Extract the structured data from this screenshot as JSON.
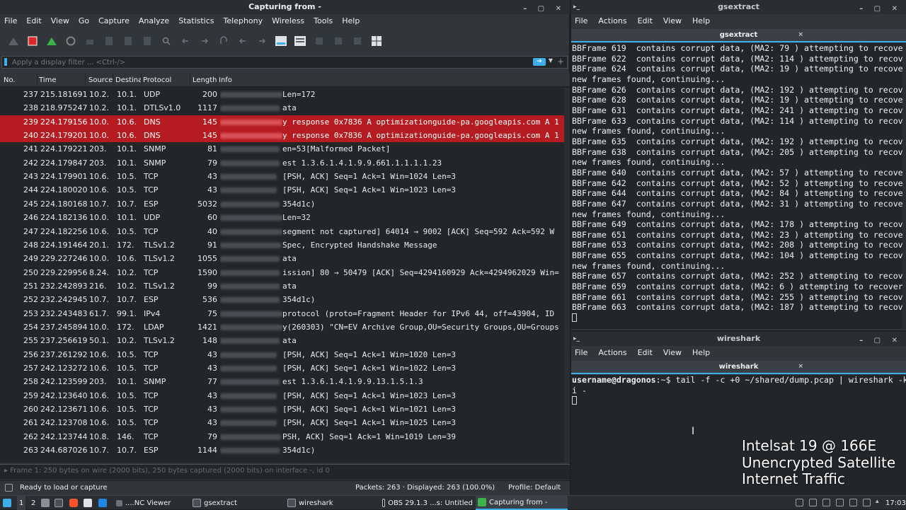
{
  "wireshark": {
    "title": "Capturing from -",
    "window_buttons": "– ▢ ✕",
    "menu": [
      "File",
      "Edit",
      "View",
      "Go",
      "Capture",
      "Analyze",
      "Statistics",
      "Telephony",
      "Wireless",
      "Tools",
      "Help"
    ],
    "filter_placeholder": "Apply a display filter ... <Ctrl-/>",
    "columns": [
      "No.",
      "Time",
      "Source",
      "Destinat",
      "Protocol",
      "Length",
      "Info"
    ],
    "packets": [
      {
        "no": "237",
        "time": "215.181691",
        "src": "10.2.",
        "dst": "10.1.",
        "proto": "UDP",
        "len": "200",
        "info": "Len=172",
        "blur": 88,
        "hl": false
      },
      {
        "no": "238",
        "time": "218.975247",
        "src": "10.2.",
        "dst": "10.1.",
        "proto": "DTLSv1.0",
        "len": "1117",
        "info": "ata",
        "blur": 84,
        "hl": false
      },
      {
        "no": "239",
        "time": "224.179156",
        "src": "10.0.",
        "dst": "10.6.",
        "proto": "DNS",
        "len": "145",
        "info": "y response 0x7836 A optimizationguide-pa.googleapis.com A 1",
        "blur": 88,
        "hl": true
      },
      {
        "no": "240",
        "time": "224.179201",
        "src": "10.0.",
        "dst": "10.6.",
        "proto": "DNS",
        "len": "145",
        "info": "y response 0x7836 A optimizationguide-pa.googleapis.com A 1",
        "blur": 88,
        "hl": true
      },
      {
        "no": "241",
        "time": "224.179221",
        "src": "203.",
        "dst": "10.1.",
        "proto": "SNMP",
        "len": "81",
        "info": "en=53[Malformed Packet]",
        "blur": 84,
        "hl": false
      },
      {
        "no": "242",
        "time": "224.179847",
        "src": "203.",
        "dst": "10.1.",
        "proto": "SNMP",
        "len": "79",
        "info": "est 1.3.6.1.4.1.9.9.661.1.1.1.1.23",
        "blur": 84,
        "hl": false
      },
      {
        "no": "243",
        "time": "224.179901",
        "src": "10.6.",
        "dst": "10.5.",
        "proto": "TCP",
        "len": "43",
        "info": "[PSH, ACK] Seq=1 Ack=1 Win=1024 Len=3",
        "blur": 80,
        "hl": false
      },
      {
        "no": "244",
        "time": "224.180020",
        "src": "10.6.",
        "dst": "10.5.",
        "proto": "TCP",
        "len": "43",
        "info": "[PSH, ACK] Seq=1 Ack=1 Win=1023 Len=3",
        "blur": 80,
        "hl": false
      },
      {
        "no": "245",
        "time": "224.180168",
        "src": "10.7.",
        "dst": "10.7.",
        "proto": "ESP",
        "len": "5032",
        "info": "354d1c)",
        "blur": 84,
        "hl": false
      },
      {
        "no": "246",
        "time": "224.182136",
        "src": "10.0.",
        "dst": "10.1.",
        "proto": "UDP",
        "len": "60",
        "info": "Len=32",
        "blur": 88,
        "hl": false
      },
      {
        "no": "247",
        "time": "224.182256",
        "src": "10.6.",
        "dst": "10.5.",
        "proto": "TCP",
        "len": "40",
        "info": "segment not captured] 64014 → 9002 [ACK] Seq=592 Ack=592 W",
        "blur": 88,
        "hl": false
      },
      {
        "no": "248",
        "time": "224.191464",
        "src": "20.1.",
        "dst": "172.",
        "proto": "TLSv1.2",
        "len": "91",
        "info": "Spec, Encrypted Handshake Message",
        "blur": 86,
        "hl": false
      },
      {
        "no": "249",
        "time": "229.227246",
        "src": "10.0.",
        "dst": "10.6.",
        "proto": "TLSv1.2",
        "len": "1055",
        "info": "ata",
        "blur": 84,
        "hl": false
      },
      {
        "no": "250",
        "time": "229.229956",
        "src": "8.24.",
        "dst": "10.2.",
        "proto": "TCP",
        "len": "1590",
        "info": "ission] 80 → 50479 [ACK] Seq=4294160929 Ack=4294962029 Win=",
        "blur": 84,
        "hl": false
      },
      {
        "no": "251",
        "time": "232.242893",
        "src": "216.",
        "dst": "10.2.",
        "proto": "TLSv1.2",
        "len": "99",
        "info": "ata",
        "blur": 84,
        "hl": false
      },
      {
        "no": "252",
        "time": "232.242945",
        "src": "10.7.",
        "dst": "10.7.",
        "proto": "ESP",
        "len": "536",
        "info": "354d1c)",
        "blur": 84,
        "hl": false
      },
      {
        "no": "253",
        "time": "232.243483",
        "src": "61.7.",
        "dst": "99.1.",
        "proto": "IPv4",
        "len": "75",
        "info": "protocol (proto=Fragment Header for IPv6 44, off=43904, ID",
        "blur": 88,
        "hl": false
      },
      {
        "no": "254",
        "time": "237.245894",
        "src": "10.0.",
        "dst": "172.",
        "proto": "LDAP",
        "len": "1421",
        "info": "y(260303) \"CN=EV Archive Group,OU=Security Groups,OU=Groups",
        "blur": 88,
        "hl": false
      },
      {
        "no": "255",
        "time": "237.256619",
        "src": "50.1.",
        "dst": "10.2.",
        "proto": "TLSv1.2",
        "len": "148",
        "info": "ata",
        "blur": 84,
        "hl": false
      },
      {
        "no": "256",
        "time": "237.261292",
        "src": "10.6.",
        "dst": "10.5.",
        "proto": "TCP",
        "len": "43",
        "info": "[PSH, ACK] Seq=1 Ack=1 Win=1020 Len=3",
        "blur": 80,
        "hl": false
      },
      {
        "no": "257",
        "time": "242.123272",
        "src": "10.6.",
        "dst": "10.5.",
        "proto": "TCP",
        "len": "43",
        "info": "[PSH, ACK] Seq=1 Ack=1 Win=1022 Len=3",
        "blur": 80,
        "hl": false
      },
      {
        "no": "258",
        "time": "242.123599",
        "src": "203.",
        "dst": "10.1.",
        "proto": "SNMP",
        "len": "77",
        "info": "est 1.3.6.1.4.1.9.9.13.1.5.1.3",
        "blur": 84,
        "hl": false
      },
      {
        "no": "259",
        "time": "242.123640",
        "src": "10.6.",
        "dst": "10.5.",
        "proto": "TCP",
        "len": "43",
        "info": "[PSH, ACK] Seq=1 Ack=1 Win=1023 Len=3",
        "blur": 80,
        "hl": false
      },
      {
        "no": "260",
        "time": "242.123671",
        "src": "10.6.",
        "dst": "10.5.",
        "proto": "TCP",
        "len": "43",
        "info": "[PSH, ACK] Seq=1 Ack=1 Win=1021 Len=3",
        "blur": 80,
        "hl": false
      },
      {
        "no": "261",
        "time": "242.123708",
        "src": "10.6.",
        "dst": "10.5.",
        "proto": "TCP",
        "len": "43",
        "info": "[PSH, ACK] Seq=1 Ack=1 Win=1025 Len=3",
        "blur": 80,
        "hl": false
      },
      {
        "no": "262",
        "time": "242.123744",
        "src": "10.8.",
        "dst": "146.",
        "proto": "TCP",
        "len": "79",
        "info": "PSH, ACK] Seq=1 Ack=1 Win=1019 Len=39",
        "blur": 86,
        "hl": false
      },
      {
        "no": "263",
        "time": "244.687026",
        "src": "10.7.",
        "dst": "10.7.",
        "proto": "ESP",
        "len": "1144",
        "info": "354d1c)",
        "blur": 84,
        "hl": false
      }
    ],
    "detail_line": "▸ Frame 1: 250 bytes on wire (2000 bits), 250 bytes captured (2000 bits) on interface -, id 0",
    "status": {
      "ready": "Ready to load or capture",
      "packets": "Packets: 263 · Displayed: 263 (100.0%)",
      "profile": "Profile: Default"
    }
  },
  "gsextract": {
    "title": "gsextract",
    "menu": [
      "File",
      "Actions",
      "Edit",
      "View",
      "Help"
    ],
    "tab": "gsextract",
    "tab_close": "×",
    "lines": [
      "BBFrame 619  contains corrupt data, (MA2: 79 ) attempting to recover",
      "BBFrame 622  contains corrupt data, (MA2: 114 ) attempting to recover",
      "BBFrame 624  contains corrupt data, (MA2: 19 ) attempting to recover",
      "new frames found, continuing...",
      "BBFrame 626  contains corrupt data, (MA2: 192 ) attempting to recover",
      "BBFrame 628  contains corrupt data, (MA2: 19 ) attempting to recover",
      "BBFrame 631  contains corrupt data, (MA2: 241 ) attempting to recover",
      "BBFrame 633  contains corrupt data, (MA2: 114 ) attempting to recover",
      "new frames found, continuing...",
      "BBFrame 635  contains corrupt data, (MA2: 192 ) attempting to recover",
      "BBFrame 638  contains corrupt data, (MA2: 205 ) attempting to recover",
      "new frames found, continuing...",
      "BBFrame 640  contains corrupt data, (MA2: 57 ) attempting to recover",
      "BBFrame 642  contains corrupt data, (MA2: 52 ) attempting to recover",
      "BBFrame 644  contains corrupt data, (MA2: 84 ) attempting to recover",
      "BBFrame 647  contains corrupt data, (MA2: 31 ) attempting to recover",
      "new frames found, continuing...",
      "BBFrame 649  contains corrupt data, (MA2: 178 ) attempting to recover",
      "BBFrame 651  contains corrupt data, (MA2: 23 ) attempting to recover",
      "BBFrame 653  contains corrupt data, (MA2: 208 ) attempting to recover",
      "BBFrame 655  contains corrupt data, (MA2: 104 ) attempting to recover",
      "new frames found, continuing...",
      "BBFrame 657  contains corrupt data, (MA2: 252 ) attempting to recover",
      "BBFrame 659  contains corrupt data, (MA2: 6 ) attempting to recover",
      "BBFrame 661  contains corrupt data, (MA2: 255 ) attempting to recover",
      "BBFrame 663  contains corrupt data, (MA2: 187 ) attempting to recover"
    ]
  },
  "wireshark_term": {
    "title": "wireshark",
    "menu": [
      "File",
      "Actions",
      "Edit",
      "View",
      "Help"
    ],
    "tab": "wireshark",
    "tab_close": "×",
    "prompt_user": "username@dragonos",
    "prompt_path": ":~$ ",
    "command": "tail -f -c +0 ~/shared/dump.pcap | wireshark -k -",
    "command_wrap": "i -"
  },
  "overlay": {
    "line1": "Intelsat 19 @ 166E",
    "line2": "Unencrypted Satellite",
    "line3": "Internet Traffic"
  },
  "taskbar": {
    "desk1": "1",
    "desk2": "2",
    "nc_viewer": "....NC Viewer",
    "gsextract": "gsextract",
    "wireshark": "wireshark",
    "obs": "OBS 29.1.3 ...s: Untitled",
    "capturing": "Capturing from -",
    "clock": "17:03"
  }
}
